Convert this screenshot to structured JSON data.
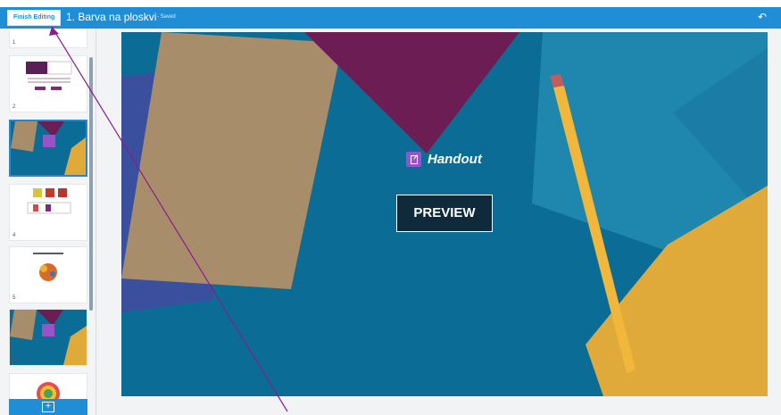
{
  "header": {
    "finish_label": "Finish Editing",
    "title": "1. Barva na ploskvi",
    "status": "- Saved",
    "undo_icon": "undo-icon"
  },
  "sidebar": {
    "slides": [
      {
        "num": "1"
      },
      {
        "num": "2"
      },
      {
        "num": "3"
      },
      {
        "num": "4"
      },
      {
        "num": "5"
      },
      {
        "num": "6"
      },
      {
        "num": ""
      }
    ],
    "add_icon": "add-slide-icon"
  },
  "slide": {
    "handout_label": "Handout",
    "preview_label": "PREVIEW",
    "accent": "#9a53c7"
  }
}
